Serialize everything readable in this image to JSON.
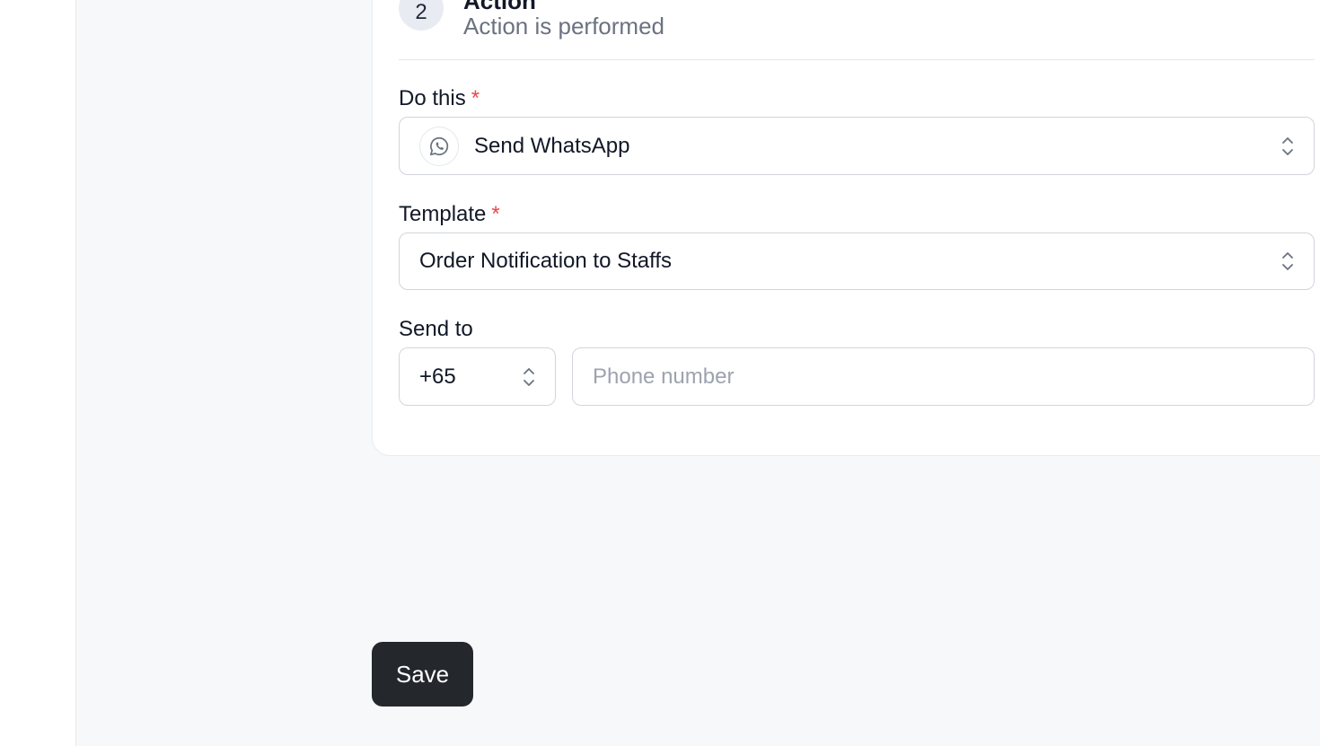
{
  "step": {
    "number": "2",
    "title": "Action",
    "subtitle": "Action is performed"
  },
  "form": {
    "do_this": {
      "label": "Do this",
      "required_mark": "*",
      "value": "Send WhatsApp",
      "icon": "whatsapp-icon"
    },
    "template": {
      "label": "Template",
      "required_mark": "*",
      "value": "Order Notification to Staffs"
    },
    "send_to": {
      "label": "Send to",
      "country_code": "+65",
      "phone_placeholder": "Phone number",
      "phone_value": ""
    }
  },
  "actions": {
    "save_label": "Save"
  },
  "colors": {
    "background": "#f7f8fa",
    "required": "#ef4444",
    "primary_button": "#24272c",
    "muted_text": "#6b7280",
    "border": "#d1d5db"
  }
}
